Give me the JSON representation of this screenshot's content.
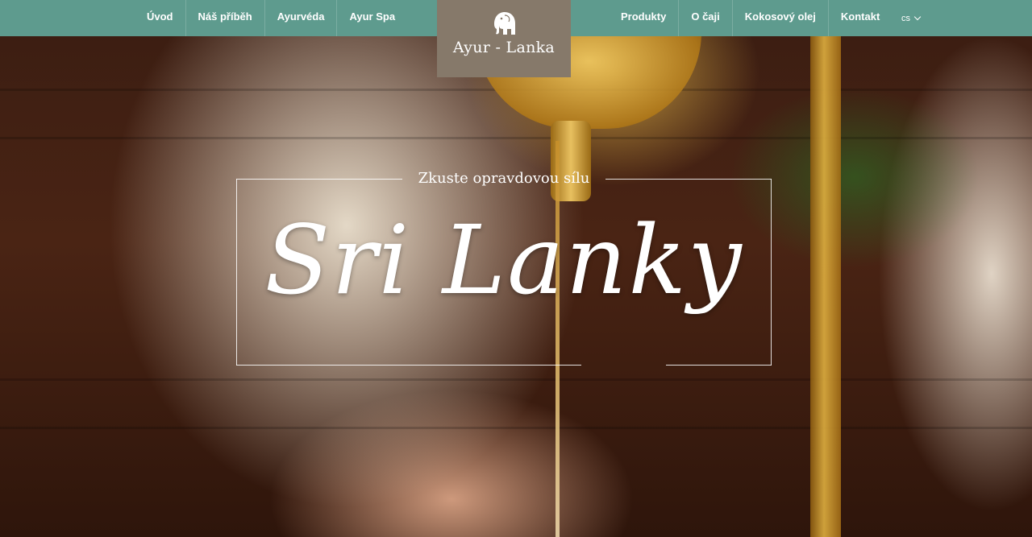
{
  "brand": {
    "logo_text": "Ayur - Lanka",
    "logo_icon": "elephant-icon"
  },
  "nav": {
    "left": [
      {
        "label": "Úvod"
      },
      {
        "label": "Náš příběh"
      },
      {
        "label": "Ayurvéda"
      },
      {
        "label": "Ayur Spa"
      }
    ],
    "right": [
      {
        "label": "Produkty"
      },
      {
        "label": "O čaji"
      },
      {
        "label": "Kokosový olej"
      },
      {
        "label": "Kontakt"
      }
    ],
    "language": "cs",
    "language_icon": "chevron-down-icon"
  },
  "hero": {
    "tagline": "Zkuste opravdovou sílu",
    "headline": "Sri Lanky"
  },
  "colors": {
    "topbar": "#5e9b8e",
    "logo_background": "#86796a",
    "text": "#ffffff"
  }
}
